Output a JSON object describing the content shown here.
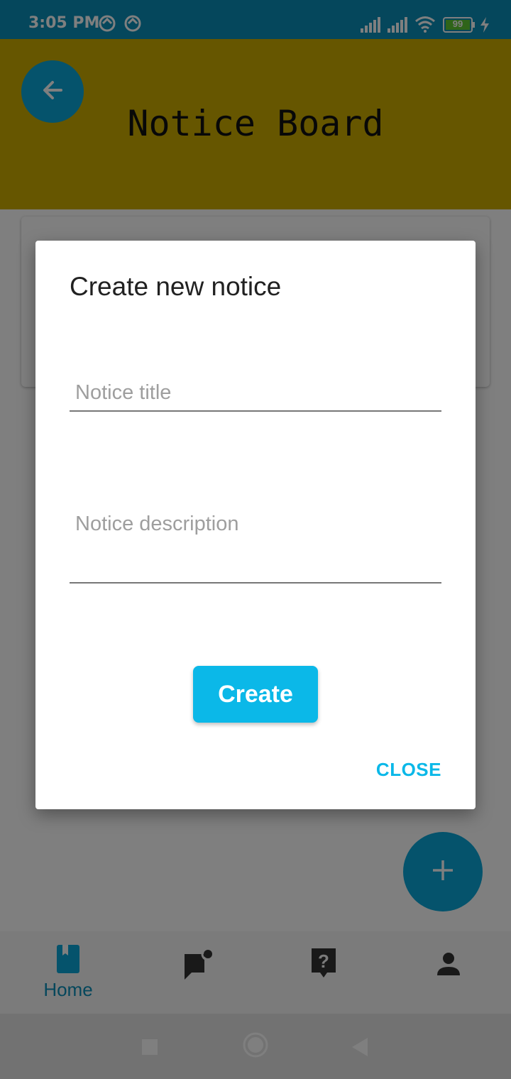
{
  "status_bar": {
    "time": "3:05 PM",
    "battery_level": "99",
    "icons": [
      "notification-icon",
      "notification-icon",
      "cell-signal-icon",
      "cell-signal-icon",
      "wifi-icon",
      "battery-icon",
      "charging-icon"
    ]
  },
  "app_bar": {
    "title": "Notice Board",
    "back_icon": "arrow-back-icon"
  },
  "dialog": {
    "title": "Create new notice",
    "title_field": {
      "value": "",
      "placeholder": "Notice title"
    },
    "description_field": {
      "value": "",
      "placeholder": "Notice description"
    },
    "create_label": "Create",
    "close_label": "CLOSE"
  },
  "fab": {
    "icon": "plus-icon"
  },
  "bottom_nav": {
    "items": [
      {
        "label": "Home",
        "icon": "bookmark-book-icon",
        "active": true
      },
      {
        "label": "",
        "icon": "chat-notification-icon",
        "active": false
      },
      {
        "label": "",
        "icon": "help-question-icon",
        "active": false
      },
      {
        "label": "",
        "icon": "person-icon",
        "active": false
      }
    ]
  },
  "system_nav": {
    "icons": [
      "recents-square-icon",
      "home-circle-icon",
      "back-triangle-icon"
    ]
  },
  "colors": {
    "status_bar": "#0a8fb8",
    "app_bar": "#ccac00",
    "accent": "#0bb8e8",
    "scrim": "rgba(0,0,0,0.5)"
  }
}
